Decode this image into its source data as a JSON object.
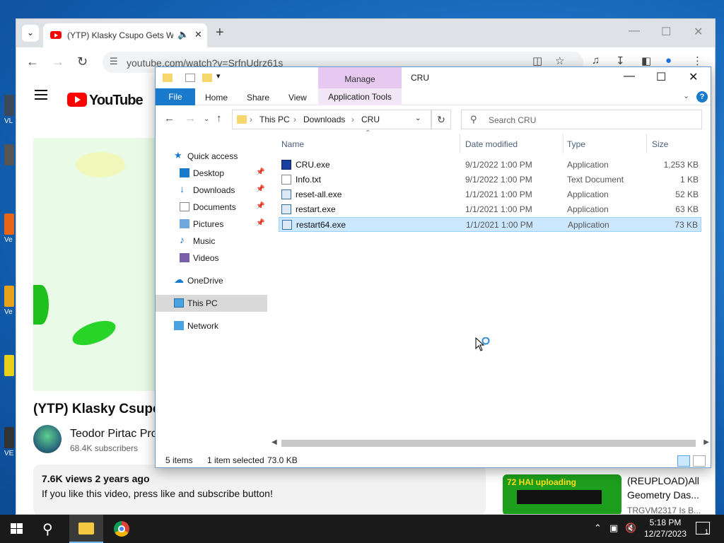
{
  "colors": {
    "accent": "#1979ca",
    "manage_tab": "#e7c8f0",
    "selection": "#cce8ff",
    "yt_red": "#ff0000"
  },
  "desktop": {
    "icon_labels": [
      "VL",
      "Ve",
      "Ve",
      "VE"
    ]
  },
  "browser": {
    "tab_title": "(YTP) Klasky Csupo Gets We",
    "tab_icon": "youtube-favicon",
    "url": "youtube.com/watch?v=SrfnUdrz61s",
    "youtube": {
      "logo_text": "YouTube",
      "video_title": "(YTP) Klasky Csupo",
      "channel_name": "Teodor Pirtac Pro",
      "subscribers": "68.4K subscribers",
      "views": "7.6K views  2 years ago",
      "description": "If you like this video, press like and subscribe button!",
      "recommended": {
        "thumb_text": "72 HAI uploading",
        "title": "(REUPLOAD)All Geometry Das...",
        "channel": "TRGVM2317 Is B..."
      }
    }
  },
  "explorer": {
    "window_title": "CRU",
    "context_tab": "Manage",
    "ribbon_tabs": [
      "File",
      "Home",
      "Share",
      "View",
      "Application Tools"
    ],
    "breadcrumb": [
      "This PC",
      "Downloads",
      "CRU"
    ],
    "search_placeholder": "Search CRU",
    "nav": [
      {
        "label": "Quick access",
        "icon": "star-icon",
        "pinned": false
      },
      {
        "label": "Desktop",
        "icon": "desktop-icon",
        "pinned": true
      },
      {
        "label": "Downloads",
        "icon": "download-icon",
        "pinned": true
      },
      {
        "label": "Documents",
        "icon": "documents-icon",
        "pinned": true
      },
      {
        "label": "Pictures",
        "icon": "pictures-icon",
        "pinned": true
      },
      {
        "label": "Music",
        "icon": "music-icon",
        "pinned": false
      },
      {
        "label": "Videos",
        "icon": "videos-icon",
        "pinned": false
      },
      {
        "label": "OneDrive",
        "icon": "cloud-icon",
        "pinned": false
      },
      {
        "label": "This PC",
        "icon": "computer-icon",
        "pinned": false
      },
      {
        "label": "Network",
        "icon": "network-icon",
        "pinned": false
      }
    ],
    "columns": [
      "Name",
      "Date modified",
      "Type",
      "Size"
    ],
    "files": [
      {
        "name": "CRU.exe",
        "date": "9/1/2022 1:00 PM",
        "type": "Application",
        "size": "1,253 KB",
        "icon": "monitor-app-icon"
      },
      {
        "name": "Info.txt",
        "date": "9/1/2022 1:00 PM",
        "type": "Text Document",
        "size": "1 KB",
        "icon": "text-file-icon"
      },
      {
        "name": "reset-all.exe",
        "date": "1/1/2021 1:00 PM",
        "type": "Application",
        "size": "52 KB",
        "icon": "app-icon"
      },
      {
        "name": "restart.exe",
        "date": "1/1/2021 1:00 PM",
        "type": "Application",
        "size": "63 KB",
        "icon": "app-icon"
      },
      {
        "name": "restart64.exe",
        "date": "1/1/2021 1:00 PM",
        "type": "Application",
        "size": "73 KB",
        "icon": "app-icon"
      }
    ],
    "selected_file": "restart64.exe",
    "status": {
      "items": "5 items",
      "selected": "1 item selected",
      "size": "73.0 KB"
    }
  },
  "taskbar": {
    "time": "5:18 PM",
    "date": "12/27/2023",
    "notification_count": "1"
  }
}
